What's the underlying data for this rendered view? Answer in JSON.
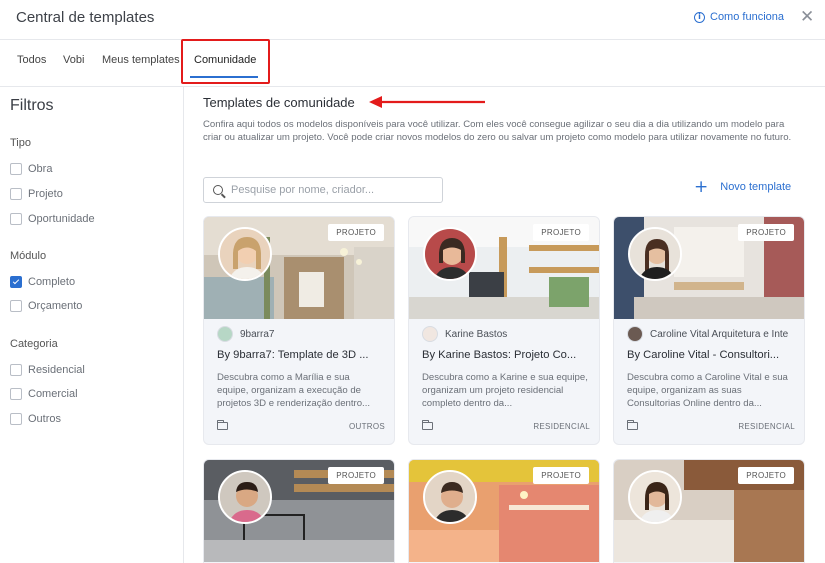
{
  "header": {
    "title": "Central de templates",
    "help_label": "Como funciona",
    "close_glyph": "✕"
  },
  "tabs": [
    {
      "label": "Todos",
      "active": false
    },
    {
      "label": "Vobi",
      "active": false
    },
    {
      "label": "Meus templates",
      "active": false
    },
    {
      "label": "Comunidade",
      "active": true
    }
  ],
  "sidebar": {
    "title": "Filtros",
    "groups": [
      {
        "title": "Tipo",
        "options": [
          {
            "label": "Obra",
            "checked": false
          },
          {
            "label": "Projeto",
            "checked": false
          },
          {
            "label": "Oportunidade",
            "checked": false
          }
        ]
      },
      {
        "title": "Módulo",
        "options": [
          {
            "label": "Completo",
            "checked": true
          },
          {
            "label": "Orçamento",
            "checked": false
          }
        ]
      },
      {
        "title": "Categoria",
        "options": [
          {
            "label": "Residencial",
            "checked": false
          },
          {
            "label": "Comercial",
            "checked": false
          },
          {
            "label": "Outros",
            "checked": false
          }
        ]
      }
    ]
  },
  "main": {
    "section_title": "Templates de comunidade",
    "description": "Confira aqui todos os modelos disponíveis para você utilizar. Com eles você consegue agilizar o seu dia a dia utilizando um modelo para criar ou atualizar um projeto. Você pode criar novos modelos do zero ou salvar um projeto como modelo para utilizar novamente no futuro.",
    "search_placeholder": "Pesquise por nome, criador...",
    "new_template_label": "Novo template",
    "accent_color": "#2b6fd0",
    "annotation_color": "#e31b1b"
  },
  "cards": [
    {
      "badge": "PROJETO",
      "author": "9barra7",
      "title": "By 9barra7: Template de 3D ...",
      "description": "Descubra como a Marília e sua equipe, organizam a execução de projetos 3D e renderização dentro...",
      "category": "OUTROS"
    },
    {
      "badge": "PROJETO",
      "author": "Karine Bastos",
      "title": "By Karine Bastos: Projeto Co...",
      "description": "Descubra como a Karine e sua equipe, organizam um projeto residencial completo dentro da...",
      "category": "RESIDENCIAL"
    },
    {
      "badge": "PROJETO",
      "author": "Caroline Vital Arquitetura e Inte",
      "title": "By Caroline Vital - Consultori...",
      "description": "Descubra como a Caroline Vital e sua equipe, organizam as suas Consultorias Online dentro da...",
      "category": "RESIDENCIAL"
    },
    {
      "badge": "PROJETO"
    },
    {
      "badge": "PROJETO"
    },
    {
      "badge": "PROJETO"
    }
  ]
}
